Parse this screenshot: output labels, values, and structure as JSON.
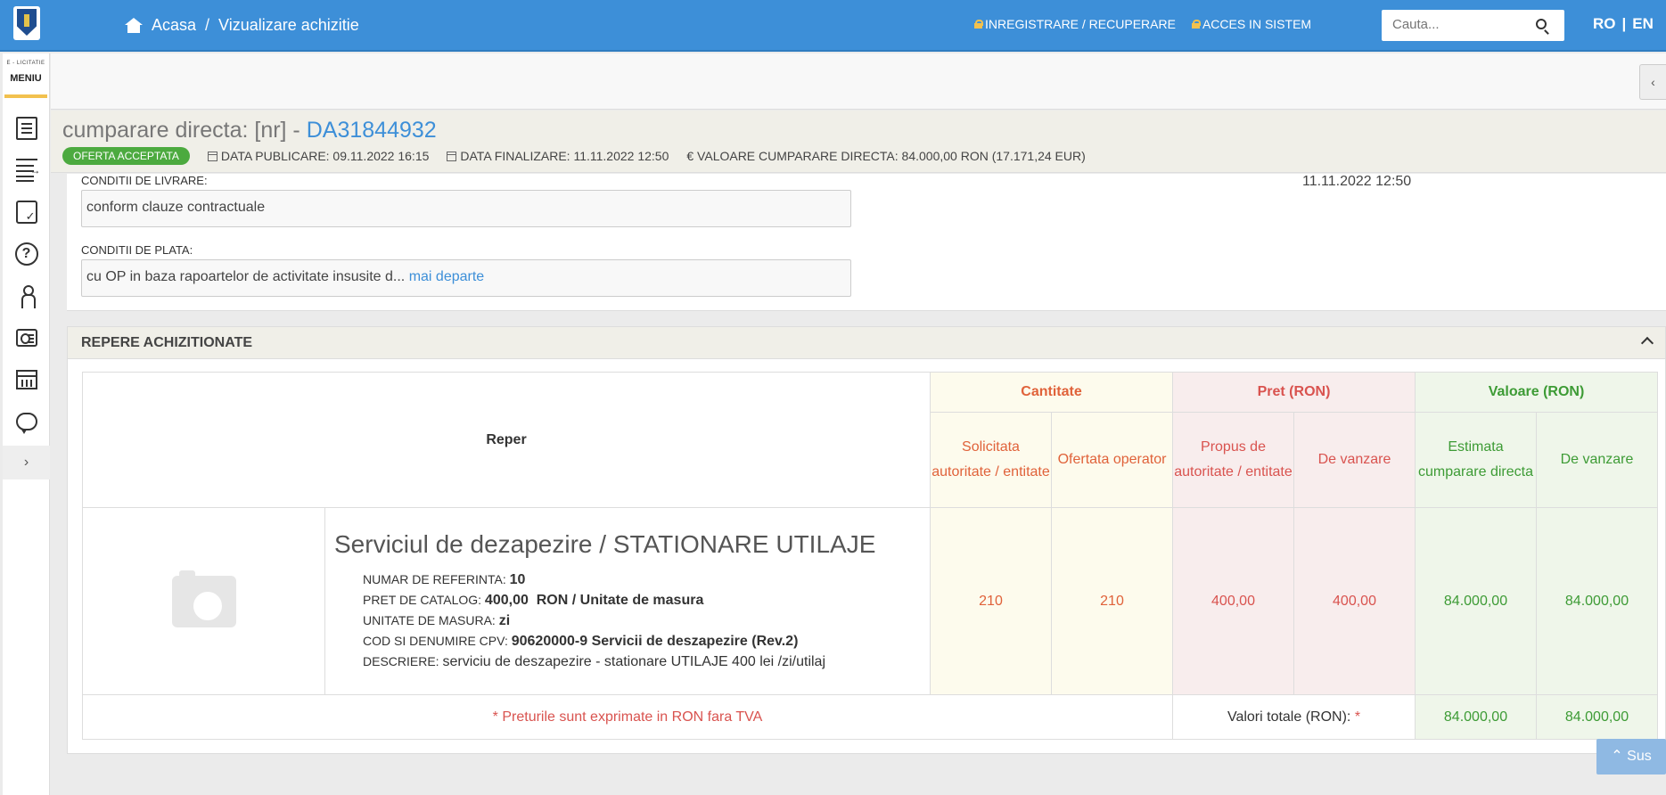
{
  "nav": {
    "home_label": "Acasa",
    "separator": "/",
    "current_page": "Vizualizare achizitie",
    "register_link": "INREGISTRARE / RECUPERARE",
    "login_link": "ACCES IN SISTEM",
    "search_placeholder": "Cauta...",
    "lang_ro": "RO",
    "lang_sep": "|",
    "lang_en": "EN"
  },
  "sidebar": {
    "brand": "E - LICITATIE",
    "menu_label": "MENIU",
    "icons": [
      "document-icon",
      "list-export-icon",
      "check-folder-icon",
      "help-icon",
      "person-icon",
      "id-card-icon",
      "calendar-icon",
      "chat-icon"
    ],
    "expand_label": "›"
  },
  "collapse_label": "‹",
  "header": {
    "title_prefix": "cumparare directa: [nr] - ",
    "code": "DA31844932",
    "status_badge": "OFERTA ACCEPTATA",
    "data_publicare": "DATA PUBLICARE: 09.11.2022 16:15",
    "data_finalizare": "DATA FINALIZARE: 11.11.2022 12:50",
    "valoare": "€ VALOARE CUMPARARE DIRECTA: 84.000,00  RON (17.171,24  EUR)"
  },
  "conditions": {
    "livrare_label": "CONDITII DE LIVRARE:",
    "livrare_value": "conform clauze contractuale",
    "plata_label": "CONDITII DE PLATA:",
    "plata_value": "cu OP in baza rapoartelor de activitate insusite d...",
    "plata_more": "mai departe",
    "side_date": "11.11.2022 12:50"
  },
  "repere": {
    "section_title": "REPERE ACHIZITIONATE",
    "col_reper": "Reper",
    "grp_cantitate": "Cantitate",
    "grp_pret": "Pret (RON)",
    "grp_valoare": "Valoare (RON)",
    "sub_solicitata": "Solicitata autoritate / entitate",
    "sub_ofertata": "Ofertata operator",
    "sub_propus": "Propus de autoritate / entitate",
    "sub_de_vanzare_pret": "De vanzare",
    "sub_estimata": "Estimata cumparare directa",
    "sub_de_vanzare_val": "De vanzare",
    "item": {
      "title": "Serviciul de dezapezire / STATIONARE UTILAJE",
      "nr_ref_label": "NUMAR DE REFERINTA:",
      "nr_ref_value": "10",
      "pret_catalog_label": "PRET DE CATALOG:",
      "pret_catalog_value": "400,00  RON / Unitate de masura",
      "um_label": "UNITATE DE MASURA:",
      "um_value": "zi",
      "cpv_label": "COD SI DENUMIRE CPV:",
      "cpv_value": "90620000-9 Servicii de deszapezire (Rev.2)",
      "descriere_label": "DESCRIERE:",
      "descriere_value": "serviciu de deszapezire - stationare UTILAJE 400 lei /zi/utilaj",
      "cant_solicitata": "210",
      "cant_ofertata": "210",
      "pret_propus": "400,00",
      "pret_vanzare": "400,00",
      "val_estimata": "84.000,00",
      "val_vanzare": "84.000,00"
    },
    "note": "* Preturile sunt exprimate in RON fara TVA",
    "totals_label": "Valori totale (RON):",
    "totals_star": "*",
    "total_estimata": "84.000,00",
    "total_vanzare": "84.000,00"
  },
  "scroll_top_label": "Sus",
  "colors": {
    "topbar": "#3d8fd8",
    "badge": "#4caa3f",
    "qty_text": "#e0623a",
    "price_text": "#d9534f",
    "value_text": "#3d9b35"
  }
}
